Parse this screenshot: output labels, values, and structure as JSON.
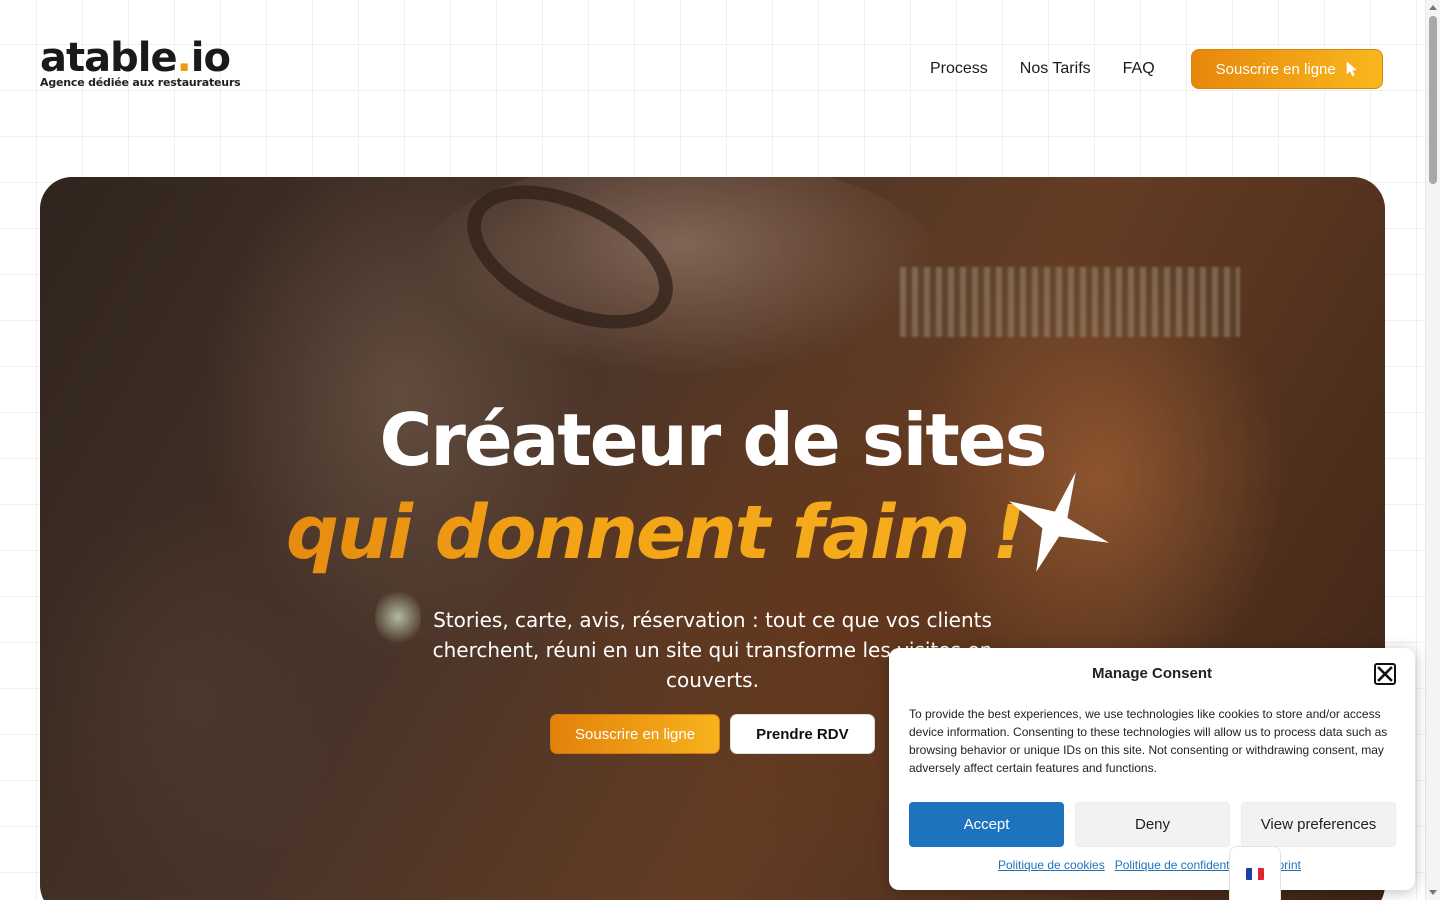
{
  "header": {
    "logo": {
      "text_main": "atable",
      "text_dot": ".",
      "text_suffix": "io",
      "tagline": "Agence dédiée aux restaurateurs"
    },
    "nav": [
      {
        "label": "Process"
      },
      {
        "label": "Nos Tarifs"
      },
      {
        "label": "FAQ"
      }
    ],
    "cta_label": "Souscrire en ligne",
    "cta_icon": "cursor-icon"
  },
  "hero": {
    "title_line1": "Créateur de sites",
    "title_line2": "qui donnent faim !",
    "subtitle": "Stories, carte, avis, réservation : tout ce que vos clients cherchent, réuni en un site qui transforme les visites en couverts.",
    "primary_button": "Souscrire en ligne",
    "secondary_button": "Prendre RDV",
    "accent_colors": [
      "#e4820b",
      "#f6b21d"
    ]
  },
  "consent": {
    "title": "Manage Consent",
    "body": "To provide the best experiences, we use technologies like cookies to store and/or access device information. Consenting to these technologies will allow us to process data such as browsing behavior or unique IDs on this site. Not consenting or withdrawing consent, may adversely affect certain features and functions.",
    "accept": "Accept",
    "deny": "Deny",
    "preferences": "View preferences",
    "links": [
      "Politique de cookies",
      "Politique de confidentialité",
      "Imprint"
    ],
    "accept_color": "#1e73be"
  },
  "language": {
    "icon": "france-flag-icon"
  }
}
